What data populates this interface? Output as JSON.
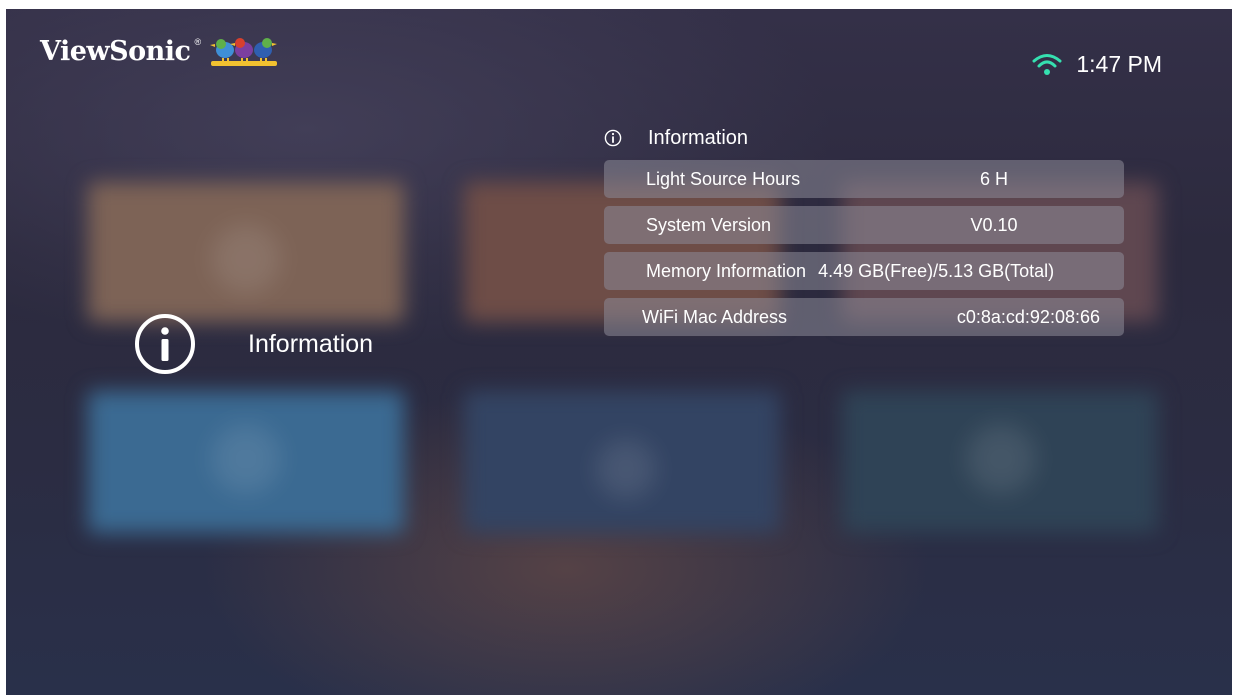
{
  "brand": {
    "name": "ViewSonic",
    "registered_mark": "®",
    "logo_icon": "viewsonic-birds-icon"
  },
  "status_bar": {
    "wifi_icon": "wifi-icon",
    "time": "1:47 PM"
  },
  "menu": {
    "selected_icon": "info-icon",
    "selected_label": "Information"
  },
  "panel": {
    "header_icon": "info-icon",
    "title": "Information",
    "rows": [
      {
        "label": "Light Source Hours",
        "value": "6 H"
      },
      {
        "label": "System Version",
        "value": "V0.10"
      },
      {
        "label": "Memory Information",
        "value": "4.49 GB(Free)/5.13 GB(Total)"
      },
      {
        "label": "WiFi Mac Address",
        "value": "c0:8a:cd:92:08:66"
      }
    ]
  },
  "colors": {
    "background": "#2c2b40",
    "row_fill": "#7e7c8a",
    "text": "#ffffff"
  }
}
